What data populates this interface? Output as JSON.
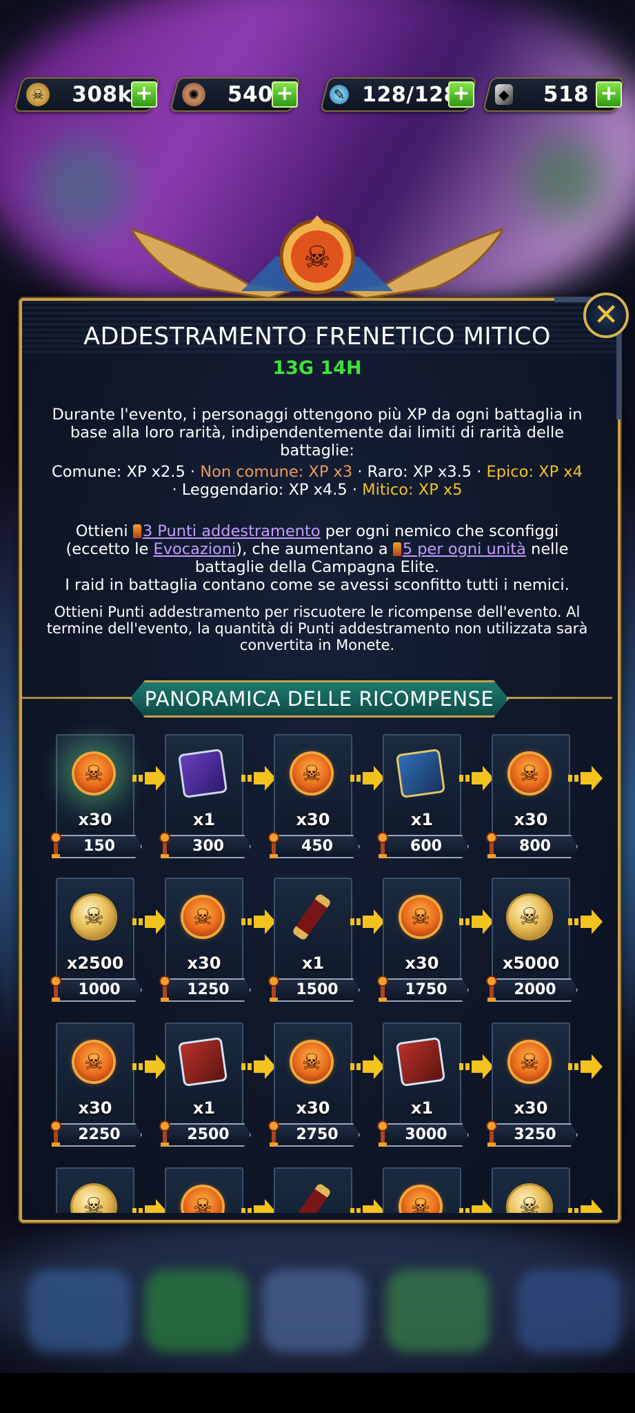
{
  "resources": [
    {
      "icon": "skull-coin-icon",
      "value": "308k",
      "plus": "+"
    },
    {
      "icon": "gear-token-icon",
      "value": "540",
      "plus": "+"
    },
    {
      "icon": "energy-vial-icon",
      "value": "128/128",
      "plus": "+"
    },
    {
      "icon": "blackstone-icon",
      "value": "518",
      "plus": "+"
    }
  ],
  "dialog": {
    "title": "ADDESTRAMENTO FRENETICO MITICO",
    "timer": "13G 14H",
    "close": "✕",
    "intro": "Durante l'evento, i personaggi ottengono più XP da ogni battaglia in base alla loro rarità, indipendentemente dai limiti di rarità delle battaglie:",
    "rarity": {
      "common": "Comune: XP x2.5",
      "uncommon": "Non comune: XP x3",
      "rare": "Raro: XP x3.5",
      "epic": "Epico: XP x4",
      "legendary": "Leggendario: XP x4.5",
      "mythic": "Mitico: XP x5",
      "sep": " · "
    },
    "points": {
      "pre": "Ottieni ",
      "link1": "3 Punti addestramento",
      "mid1": " per ogni nemico che sconfiggi (eccetto le ",
      "link2": "Evocazioni",
      "mid2": "), che aumentano a ",
      "link3": "5 per ogni unità",
      "post": " nelle battaglie della Campagna Elite.",
      "raid": "I raid in battaglia contano come se avessi sconfitto tutti i nemici."
    },
    "claim": "Ottieni Punti addestramento per riscuotere le ricompense dell'evento. Al termine dell'evento, la quantità di Punti addestramento non utilizzata sarà convertita in Monete.",
    "rewards_banner": "PANORAMICA DELLE RICOMPENSE"
  },
  "rewards": [
    {
      "item": "skull-badge-icon",
      "qty": "x30",
      "cost": "150",
      "glow": true
    },
    {
      "item": "purple-book-icon",
      "qty": "x1",
      "cost": "300"
    },
    {
      "item": "skull-badge-icon",
      "qty": "x30",
      "cost": "450"
    },
    {
      "item": "blue-book-icon",
      "qty": "x1",
      "cost": "600"
    },
    {
      "item": "skull-badge-icon",
      "qty": "x30",
      "cost": "800"
    },
    {
      "item": "gold-coin-icon",
      "qty": "x2500",
      "cost": "1000"
    },
    {
      "item": "skull-badge-icon",
      "qty": "x30",
      "cost": "1250"
    },
    {
      "item": "scroll-icon",
      "qty": "x1",
      "cost": "1500"
    },
    {
      "item": "skull-badge-icon",
      "qty": "x30",
      "cost": "1750"
    },
    {
      "item": "gold-coin-icon",
      "qty": "x5000",
      "cost": "2000"
    },
    {
      "item": "skull-badge-icon",
      "qty": "x30",
      "cost": "2250"
    },
    {
      "item": "red-book-icon",
      "qty": "x1",
      "cost": "2500"
    },
    {
      "item": "skull-badge-icon",
      "qty": "x30",
      "cost": "2750"
    },
    {
      "item": "red-book-icon",
      "qty": "x1",
      "cost": "3000"
    },
    {
      "item": "skull-badge-icon",
      "qty": "x30",
      "cost": "3250"
    },
    {
      "item": "gold-coin-icon",
      "qty": "",
      "cost": ""
    },
    {
      "item": "skull-badge-icon",
      "qty": "",
      "cost": ""
    },
    {
      "item": "scroll-icon",
      "qty": "",
      "cost": ""
    },
    {
      "item": "skull-badge-icon",
      "qty": "",
      "cost": ""
    },
    {
      "item": "gold-coin-icon",
      "qty": "",
      "cost": ""
    }
  ],
  "colors": {
    "title": "#ffffff",
    "timer": "#3fe23c",
    "uncommon": "#ee9a5a",
    "epic": "#f6c21f",
    "mythic": "#f6c21f",
    "link": "#c49bff",
    "frame_gold": "#c9a04a"
  }
}
